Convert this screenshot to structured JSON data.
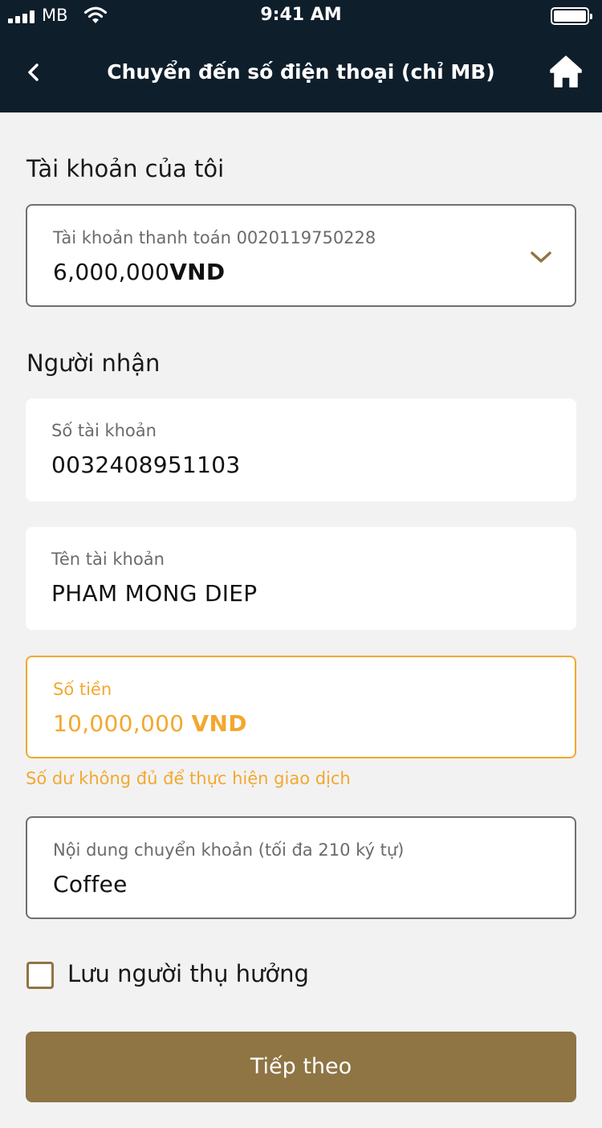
{
  "status_bar": {
    "carrier": "MB",
    "time": "9:41 AM"
  },
  "nav": {
    "title": "Chuyển đến số điện thoại (chỉ MB)"
  },
  "my_account": {
    "section_title": "Tài khoản của tôi",
    "account_label": "Tài khoản thanh toán 0020119750228",
    "balance_amount": "6,000,000",
    "balance_currency": "VND"
  },
  "recipient": {
    "section_title": "Người nhận",
    "account_number_label": "Số tài khoản",
    "account_number_value": "0032408951103",
    "account_name_label": "Tên tài khoản",
    "account_name_value": "PHAM MONG DIEP"
  },
  "amount": {
    "label": "Số tiền",
    "value": "10,000,000",
    "currency": "VND",
    "error": "Số dư không đủ để thực hiện giao dịch"
  },
  "description": {
    "label": "Nội dung chuyển khoản (tối đa 210 ký tự)",
    "value": "Coffee"
  },
  "save_beneficiary": {
    "label": "Lưu người thụ hưởng",
    "checked": false
  },
  "actions": {
    "next_label": "Tiếp theo"
  },
  "colors": {
    "header_bg": "#0f1e2b",
    "accent_gold": "#8f7444",
    "warning_orange": "#f2a82f",
    "page_bg": "#f2f2f2"
  },
  "icons": {
    "back": "chevron-left-icon",
    "home": "home-icon",
    "dropdown": "chevron-down-icon"
  }
}
